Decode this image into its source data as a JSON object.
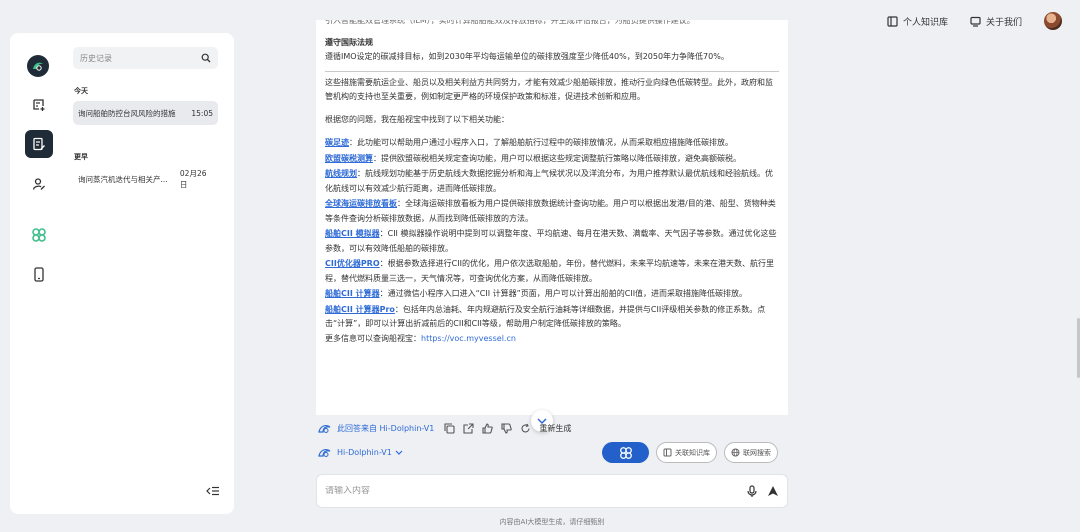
{
  "header": {
    "knowledge_base": "个人知识库",
    "about_us": "关于我们"
  },
  "sidebar": {
    "search_placeholder": "历史记录",
    "groups": [
      {
        "label": "今天",
        "items": [
          {
            "title": "询问船舶防控台风风险的措施",
            "date": "15:05"
          }
        ]
      },
      {
        "label": "更早",
        "items": [
          {
            "title": "询问蒸汽机迭代与相关产...",
            "date": "02月26日"
          }
        ]
      }
    ]
  },
  "answer": {
    "clipped_top": "引入智能能效管理系统（ILM），实时计算船舶能效及排放指标，并生成评估报告，为船员提供操作建议。",
    "section_title": "遵守国际法规",
    "section_text": "遵循IMO设定的碳减排目标，如到2030年平均每运输单位的碳排放强度至少降低40%，到2050年力争降低70%。",
    "summary": "这些措施需要航运企业、船员以及相关利益方共同努力，才能有效减少船舶碳排放，推动行业向绿色低碳转型。此外，政府和监管机构的支持也至关重要，例如制定更严格的环境保护政策和标准，促进技术创新和应用。",
    "intro": "根据您的问题，我在船视宝中找到了以下相关功能：",
    "features": [
      {
        "name": "碳足迹",
        "desc": "：此功能可以帮助用户通过小程序入口，了解船舶航行过程中的碳排放情况，从而采取相应措施降低碳排放。"
      },
      {
        "name": "欧盟碳税测算",
        "desc": "：提供欧盟碳税相关规定查询功能，用户可以根据这些规定调整航行策略以降低碳排放，避免高额碳税。"
      },
      {
        "name": "航线规划",
        "desc": "：航线规划功能基于历史航线大数据挖掘分析和海上气候状况以及洋流分布，为用户推荐默认最优航线和经验航线。优化航线可以有效减少航行距离，进而降低碳排放。"
      },
      {
        "name": "全球海运碳排放看板",
        "desc": "：全球海运碳排放看板为用户提供碳排放数据统计查询功能。用户可以根据出发港/目的港、船型、货物种类等条件查询分析碳排放数据，从而找到降低碳排放的方法。"
      },
      {
        "name": "船舶CII 模拟器",
        "desc": "：CII 模拟器操作说明中提到可以调整年度、平均航速、每月在港天数、满载率、天气因子等参数。通过优化这些参数，可以有效降低船舶的碳排放。"
      },
      {
        "name": "CII优化器PRO",
        "desc": "：根据参数选择进行CII的优化，用户依次选取船舶，年份，替代燃料，未来平均航速等，未来在港天数、航行里程，替代燃料质量三选一，天气情况等，可查询优化方案，从而降低碳排放。"
      },
      {
        "name": "船舶CII 计算器",
        "desc": "：通过微信小程序入口进入“CII 计算器”页面，用户可以计算出船舶的CII值，进而采取措施降低碳排放。"
      },
      {
        "name": "船舶CII 计算器Pro",
        "desc": "：包括年内总油耗、年内规避航行及安全航行油耗等详细数据，并提供与CII评级相关参数的修正系数。点击“计算”，即可以计算出折减前后的CII和CII等级，帮助用户制定降低碳排放的策略。"
      }
    ],
    "more_prefix": "更多信息可以查询船视宝：",
    "more_url": "https://voc.myvessel.cn"
  },
  "actions": {
    "source": "此回答来自 Hi-Dolphin-V1",
    "regenerate": "重新生成"
  },
  "model": {
    "name": "Hi-Dolphin-V1"
  },
  "tools": {
    "kb_label": "关联知识库",
    "web_label": "联网搜索"
  },
  "composer": {
    "placeholder": "请输入内容"
  },
  "footer": {
    "disclaimer": "内容由AI大模型生成，请仔细甄别"
  },
  "colors": {
    "accent": "#2360c9",
    "link": "#2f6bd6",
    "rail_active": "#1f2b36",
    "logo_green": "#3fc08a"
  }
}
